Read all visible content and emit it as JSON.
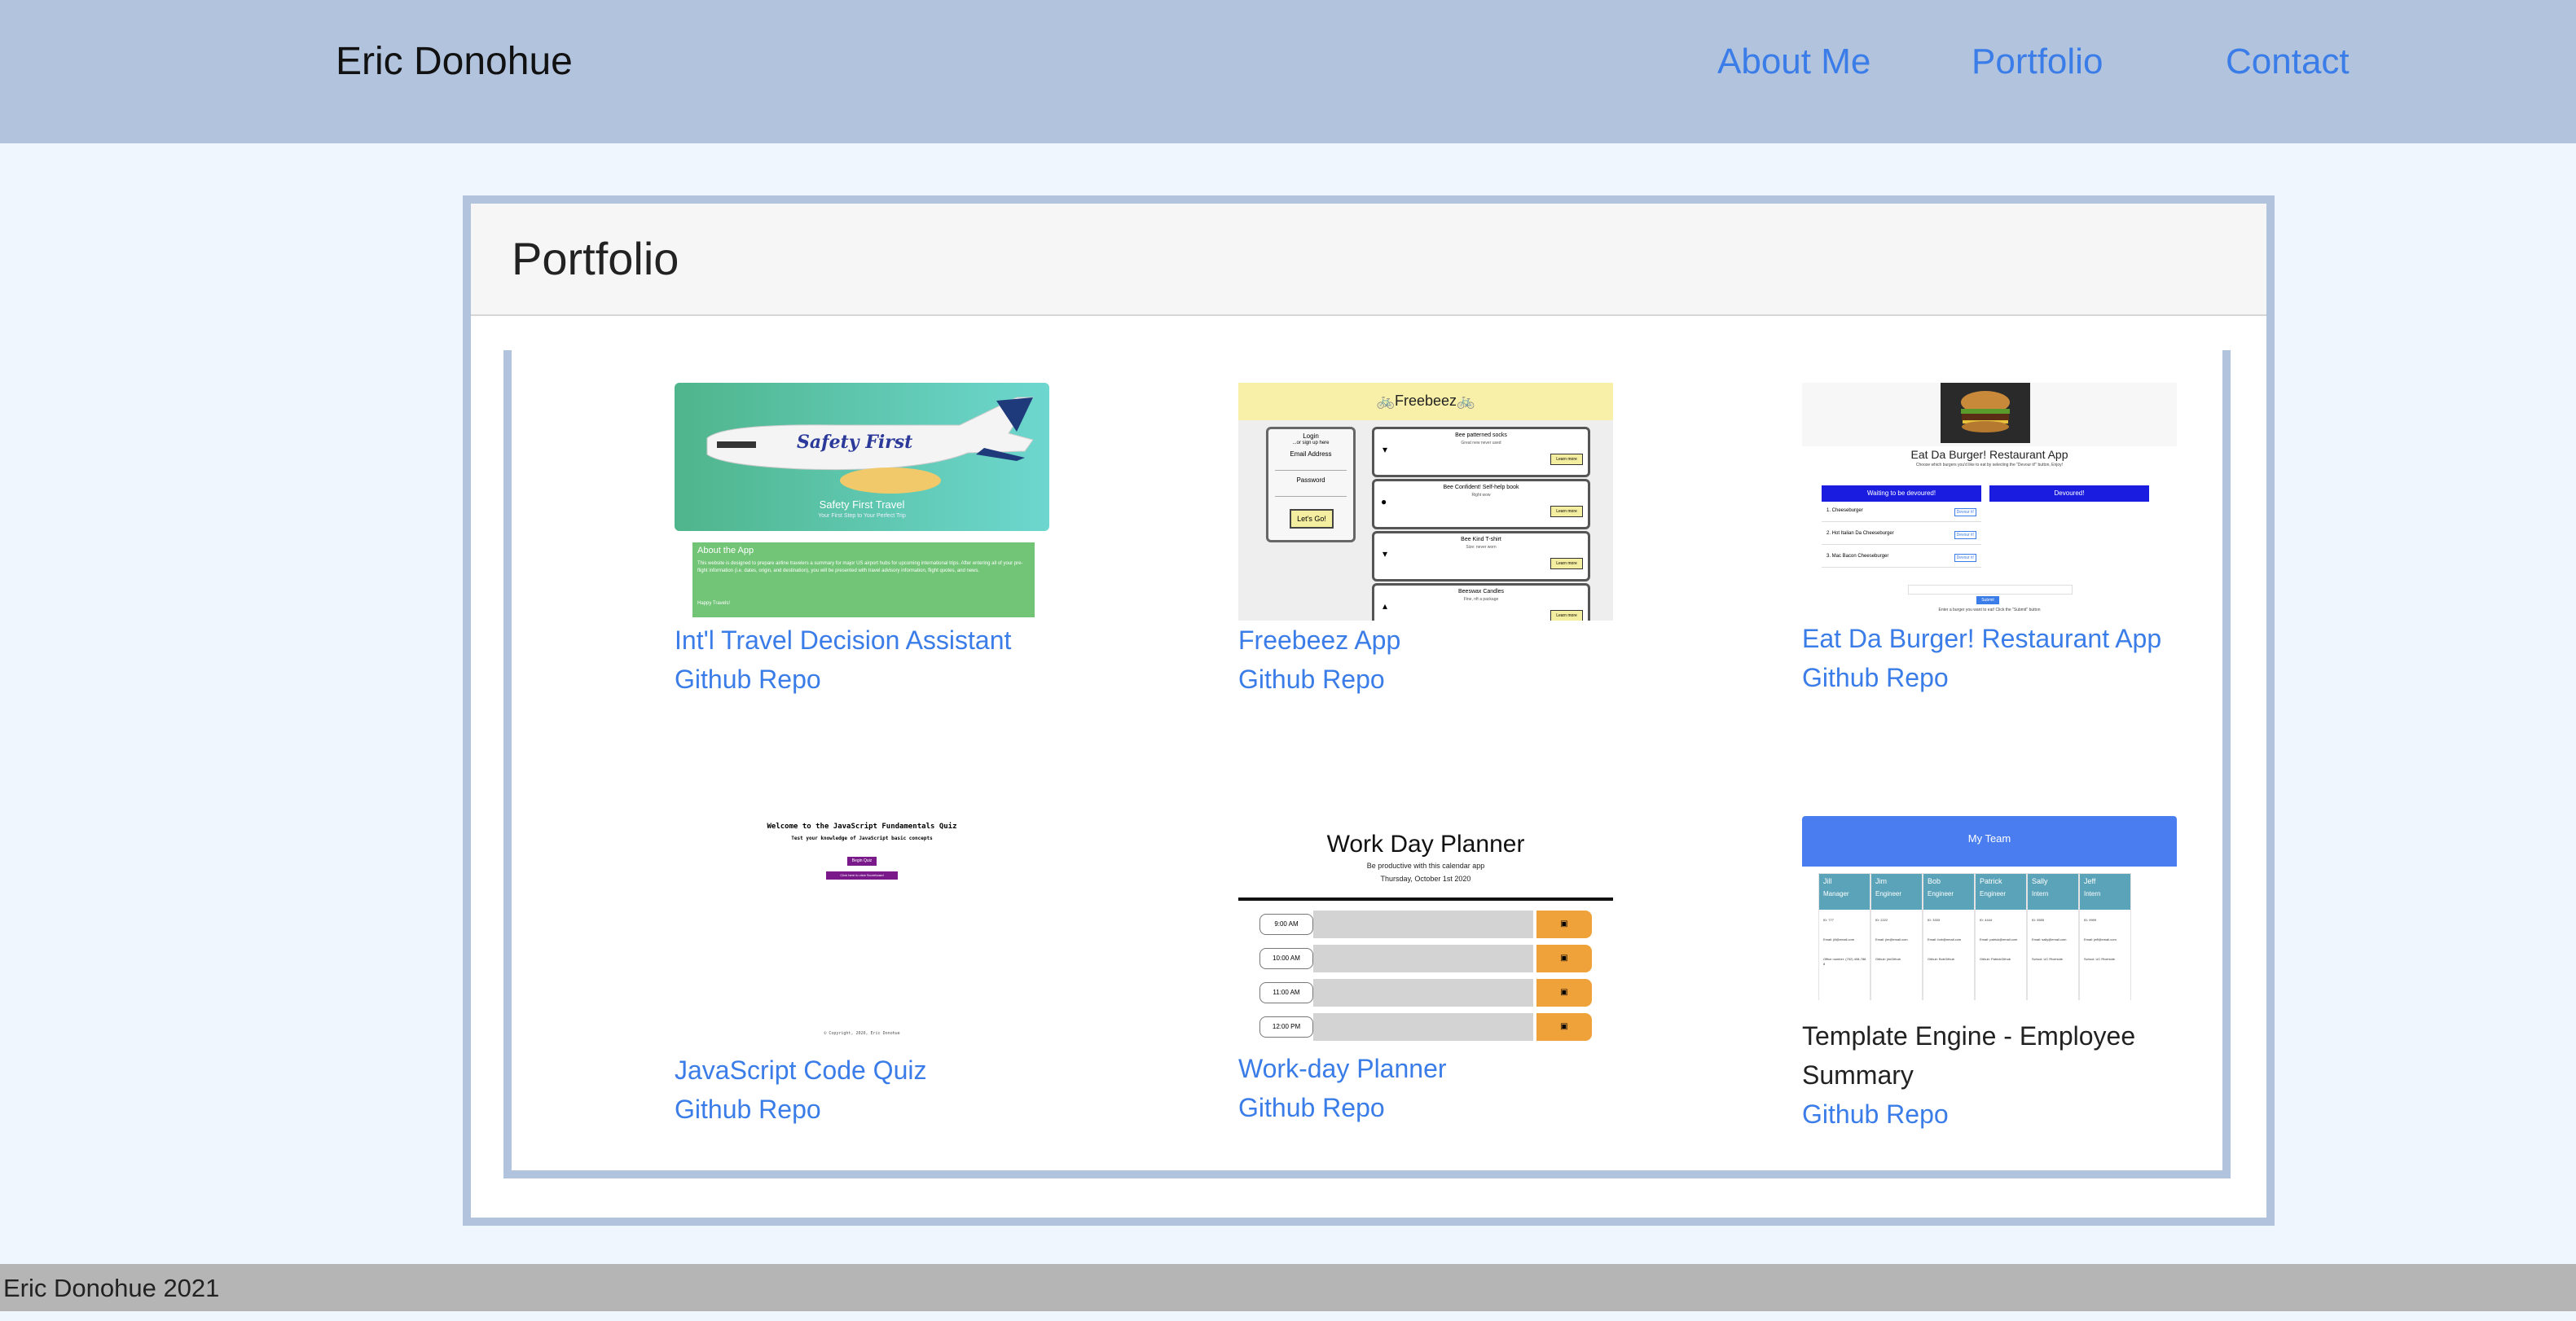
{
  "nav": {
    "brand": "Eric Donohue",
    "links": [
      "About Me",
      "Portfolio",
      "Contact"
    ]
  },
  "portfolio": {
    "title": "Portfolio",
    "projects": [
      {
        "title": "Int'l Travel Decision Assistant",
        "repo": "Github Repo",
        "thumb": {
          "logo": "Safety First",
          "heading": "Safety First Travel",
          "sub": "Your First Step to Your Perfect Trip",
          "about": "About the App",
          "about_text": "This website is designed to prepare airline travelers a summary for major US airport hubs for upcoming international trips. After entering all of your pre-flight information (i.e. dates, origin, and destination), you will be presented with travel advisory information, flight quotes, and news.",
          "sign": "Happy Travels!"
        }
      },
      {
        "title": "Freebeez App",
        "repo": "Github Repo",
        "thumb": {
          "header": "🚲Freebeez🚲",
          "login": "Login",
          "signup": "...or sign up here",
          "email": "Email Address",
          "password": "Password",
          "go": "Let's Go!",
          "items": [
            {
              "t": "Bee patterned socks",
              "s": "Great new never used"
            },
            {
              "t": "Bee Confident! Self-help book",
              "s": "Right wow"
            },
            {
              "t": "Bee Kind T-shirt",
              "s": "Size: never worn"
            },
            {
              "t": "Beeswax Candles",
              "s": "Fine, nft a package"
            }
          ],
          "btn": "Learn more"
        }
      },
      {
        "title": "Eat Da Burger! Restaurant App",
        "repo": "Github Repo",
        "thumb": {
          "heading": "Eat Da Burger! Restaurant App",
          "sub": "Choose which burgers you'd like to eat by selecting the \"Devour it!\" button, Enjoy!",
          "col1": "Waiting to be devoured!",
          "col2": "Devoured!",
          "rows": [
            "1. Cheeseburger",
            "2. Hot Italian Da Cheeseburger",
            "3. Mac Bacon Cheeseburger"
          ],
          "devour": "Devour it!",
          "submit": "Submit",
          "note": "Enter a burger you want to eat! Click the \"Submit\" button"
        }
      },
      {
        "title": "JavaScript Code Quiz",
        "repo": "Github Repo",
        "thumb": {
          "heading": "Welcome to the JavaScript Fundamentals Quiz",
          "sub": "Test your knowledge of JavaScript basic concepts",
          "btn1": "Begin Quiz",
          "btn2": "Click here to view Scoreboard",
          "copy": "© Copyright, 2020, Eric Donohue"
        }
      },
      {
        "title": "Work-day Planner",
        "repo": "Github Repo",
        "thumb": {
          "heading": "Work Day Planner",
          "sub": "Be productive with this calendar app",
          "date": "Thursday, October 1st 2020",
          "hours": [
            "9:00 AM",
            "10:00 AM",
            "11:00 AM",
            "12:00 PM"
          ]
        }
      },
      {
        "title": "Template Engine - Employee Summary",
        "repo": "Github Repo",
        "thumb": {
          "header": "My Team",
          "members": [
            {
              "name": "Jill",
              "role": "Manager",
              "id": "ID: 777",
              "email": "Email: jill@email.com",
              "extra": "Office number: (702) 408-7888"
            },
            {
              "name": "Jim",
              "role": "Engineer",
              "id": "ID: 2222",
              "email": "Email: jim@email.com",
              "extra": "Github: jimGithub"
            },
            {
              "name": "Bob",
              "role": "Engineer",
              "id": "ID: 3333",
              "email": "Email: bob@email.com",
              "extra": "Github: BobGithub"
            },
            {
              "name": "Patrick",
              "role": "Engineer",
              "id": "ID: 4444",
              "email": "Email: patrick@email.com",
              "extra": "Github: PatrickGithub"
            },
            {
              "name": "Sally",
              "role": "Intern",
              "id": "ID: 5555",
              "email": "Email: sally@email.com",
              "extra": "School: UC Riverside"
            },
            {
              "name": "Jeff",
              "role": "Intern",
              "id": "ID: 9999",
              "email": "Email: jeff@email.com",
              "extra": "School: UC Riverside"
            }
          ]
        }
      }
    ]
  },
  "footer": {
    "text": "Eric Donohue 2021"
  },
  "colors": {
    "nav_bg": "#b1c3dd",
    "page_bg": "#eff6fe",
    "link": "#3a7ce8",
    "footer_bg": "#b5b5b5"
  }
}
